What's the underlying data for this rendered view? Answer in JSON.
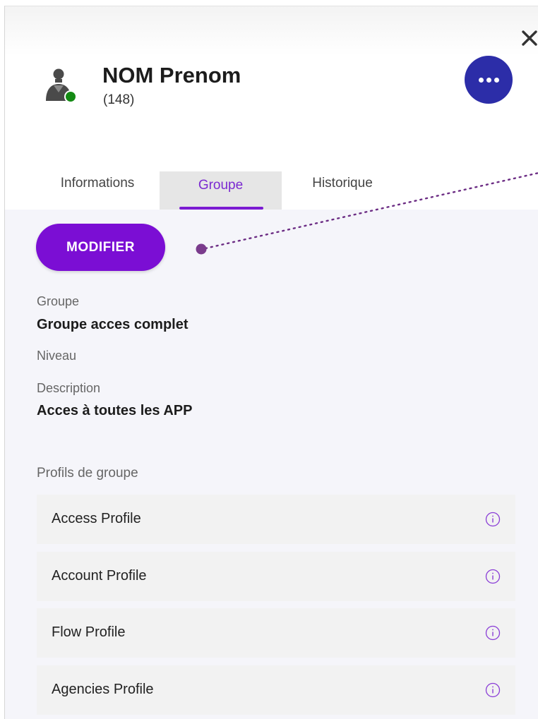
{
  "colors": {
    "accent": "#7b0ed4",
    "more_button": "#2c2da8",
    "status_online": "#148a14",
    "content_background": "#f5f5fa",
    "profile_background": "#f2f2f2"
  },
  "icons": {
    "close": "close-icon",
    "avatar": "person-icon",
    "status": "status-online-dot",
    "more": "more-horizontal-icon",
    "info": "info-icon"
  },
  "user": {
    "name": "NOM Prenom",
    "id": "(148)"
  },
  "tabs": [
    {
      "label": "Informations",
      "active": false
    },
    {
      "label": "Groupe",
      "active": true
    },
    {
      "label": "Historique",
      "active": false
    }
  ],
  "actions": {
    "modify_label": "MODIFIER"
  },
  "group": {
    "group_label": "Groupe",
    "group_value": "Groupe acces complet",
    "level_label": "Niveau",
    "level_value": "",
    "description_label": "Description",
    "description_value": "Acces à toutes les APP"
  },
  "profiles": {
    "title": "Profils de groupe",
    "items": [
      {
        "label": "Access Profile"
      },
      {
        "label": "Account Profile"
      },
      {
        "label": "Flow Profile"
      },
      {
        "label": "Agencies Profile"
      }
    ]
  }
}
